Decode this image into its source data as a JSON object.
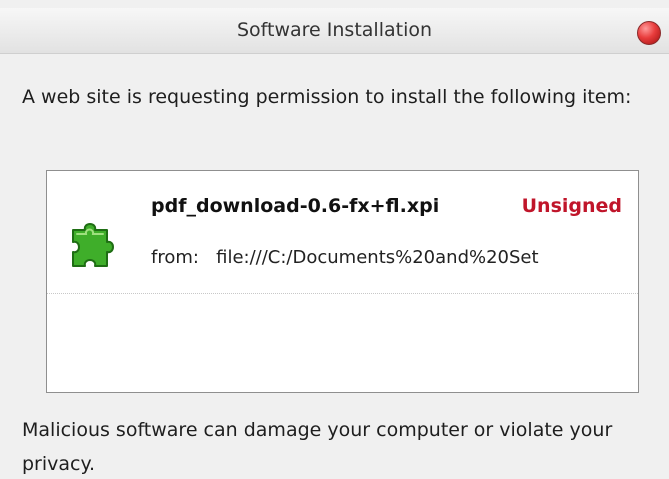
{
  "window": {
    "title": "Software Installation"
  },
  "prompt_text": "A web site is requesting permission to install the following item:",
  "item": {
    "name": "pdf_download-0.6-fx+fl.xpi",
    "status": "Unsigned",
    "from_label": "from:",
    "from_url": "file:///C:/Documents%20and%20Set",
    "icon": "puzzle-piece-icon",
    "icon_color": "#3fae2a"
  },
  "warning_text": "Malicious software can damage your computer or violate your privacy.",
  "colors": {
    "status_unsigned": "#c0152a",
    "close_button": "#e83c3c"
  }
}
